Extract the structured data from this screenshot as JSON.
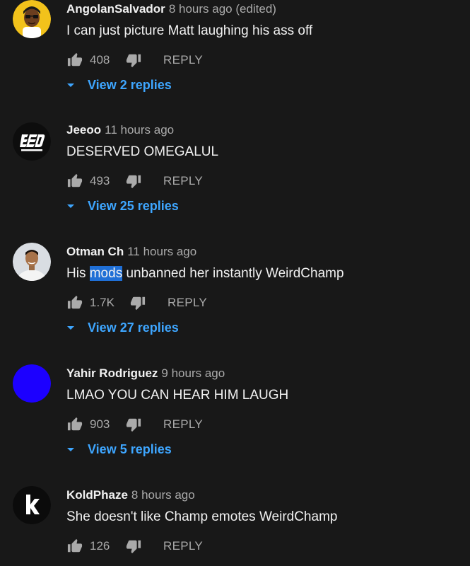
{
  "colors": {
    "background": "#181818",
    "link_blue": "#3ea6ff",
    "highlight": "#1f6fd6",
    "secondary_text": "#aaaaaa"
  },
  "comments": [
    {
      "author": "AngolanSalvador",
      "time": "8 hours ago (edited)",
      "text": "I can just picture Matt laughing his ass off",
      "likes": "408",
      "reply_label": "REPLY",
      "view_replies": "View 2 replies",
      "avatar": "cartoon-avatar"
    },
    {
      "author": "Jeeoo",
      "time": "11 hours ago",
      "text": "DESERVED OMEGALUL",
      "likes": "493",
      "reply_label": "REPLY",
      "view_replies": "View 25 replies",
      "avatar": "logo-avatar"
    },
    {
      "author": "Otman Ch",
      "time": "11 hours ago",
      "text_before": "His ",
      "text_highlight": "mods",
      "text_after": " unbanned her instantly WeirdChamp",
      "likes": "1.7K",
      "reply_label": "REPLY",
      "view_replies": "View 27 replies",
      "avatar": "photo-avatar"
    },
    {
      "author": "Yahir Rodriguez",
      "time": "9 hours ago",
      "text": "LMAO YOU CAN HEAR HIM LAUGH",
      "likes": "903",
      "reply_label": "REPLY",
      "view_replies": "View 5 replies",
      "avatar": "blue-circle-avatar"
    },
    {
      "author": "KoldPhaze",
      "time": "8 hours ago",
      "text": "She doesn't like Champ emotes WeirdChamp",
      "likes": "126",
      "reply_label": "REPLY",
      "avatar": "letter-k-avatar"
    }
  ]
}
